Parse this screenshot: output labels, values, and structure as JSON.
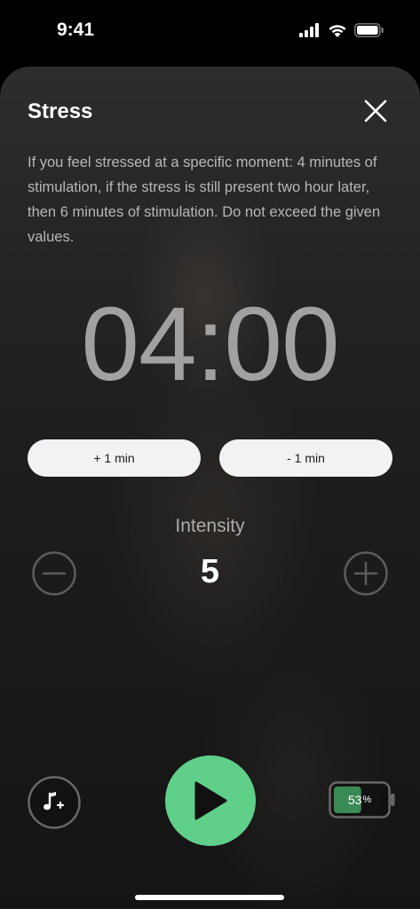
{
  "status_bar": {
    "time": "9:41",
    "icons": [
      "cellular-signal-icon",
      "wifi-icon",
      "battery-icon"
    ]
  },
  "sheet": {
    "title": "Stress",
    "close_icon": "close-icon",
    "description": "If you feel stressed at a specific moment: 4 minutes of stimulation, if the stress is still present two hour later, then 6 minutes of stimulation. Do not exceed the given values.",
    "timer": "04:00",
    "buttons": {
      "add_minute": "+ 1 min",
      "subtract_minute": "- 1 min"
    },
    "intensity": {
      "label": "Intensity",
      "value": "5",
      "decrease_icon": "minus-circle-icon",
      "increase_icon": "plus-circle-icon"
    }
  },
  "controls": {
    "music_icon": "music-add-icon",
    "play_icon": "play-icon",
    "device_battery": {
      "value": "53",
      "unit": "%",
      "level": 0.53
    }
  },
  "colors": {
    "accent_green": "#5fcf8a",
    "battery_fill": "#3a8a55",
    "pill_background": "#f2f2f4"
  }
}
